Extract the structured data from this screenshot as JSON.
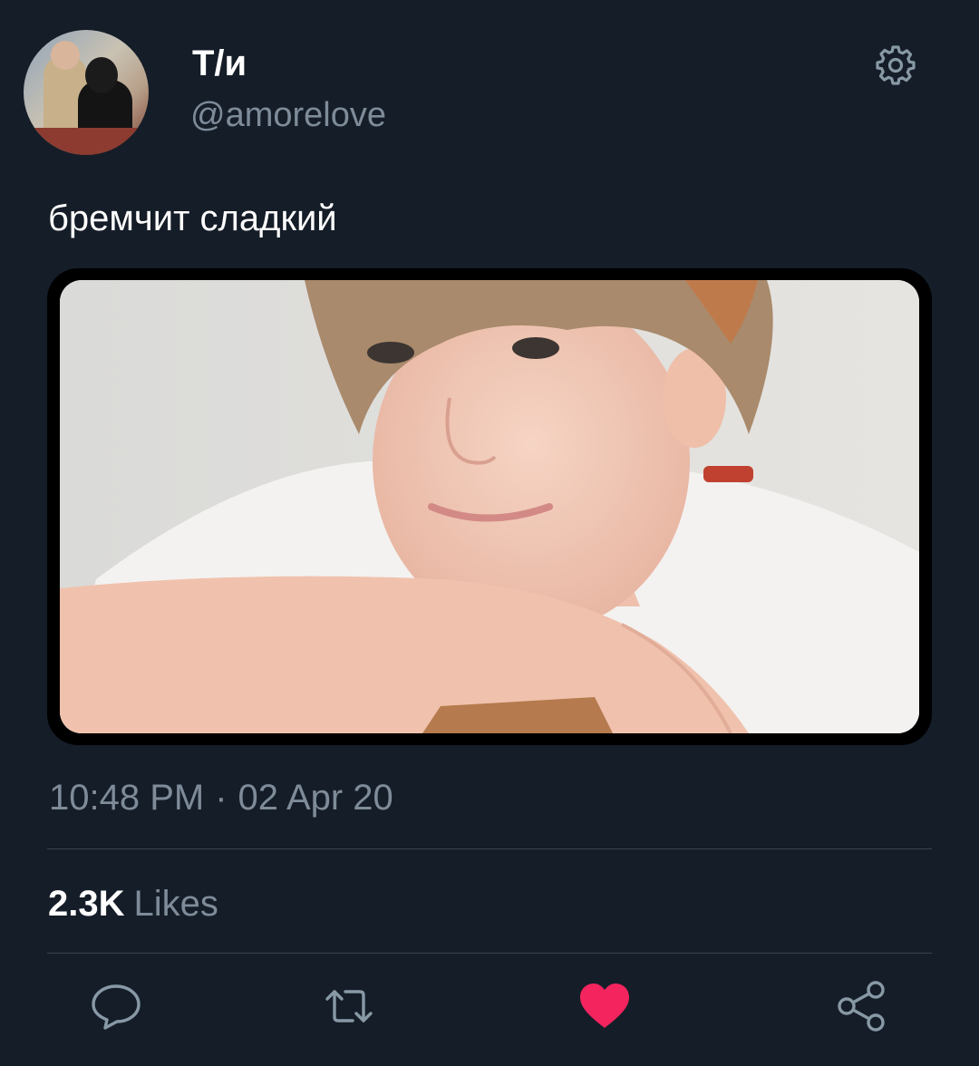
{
  "author": {
    "display_name": "Т/и",
    "handle": "@amorelove",
    "avatar_icon": "avatar"
  },
  "header": {
    "settings_icon": "gear-icon"
  },
  "tweet": {
    "text": "бремчит сладкий",
    "media_description": "photo",
    "time": "10:48 PM",
    "separator": "·",
    "date": "02 Apr 20"
  },
  "stats": {
    "likes_count": "2.3K",
    "likes_label": "Likes"
  },
  "actions": {
    "reply_icon": "reply-icon",
    "retweet_icon": "retweet-icon",
    "like_icon": "heart-icon",
    "share_icon": "share-icon",
    "liked": true,
    "like_color": "#f4245e"
  },
  "colors": {
    "background": "#151d28",
    "secondary_text": "#7e8b99",
    "divider": "#3a4550",
    "icon_gray": "#8899a6"
  }
}
